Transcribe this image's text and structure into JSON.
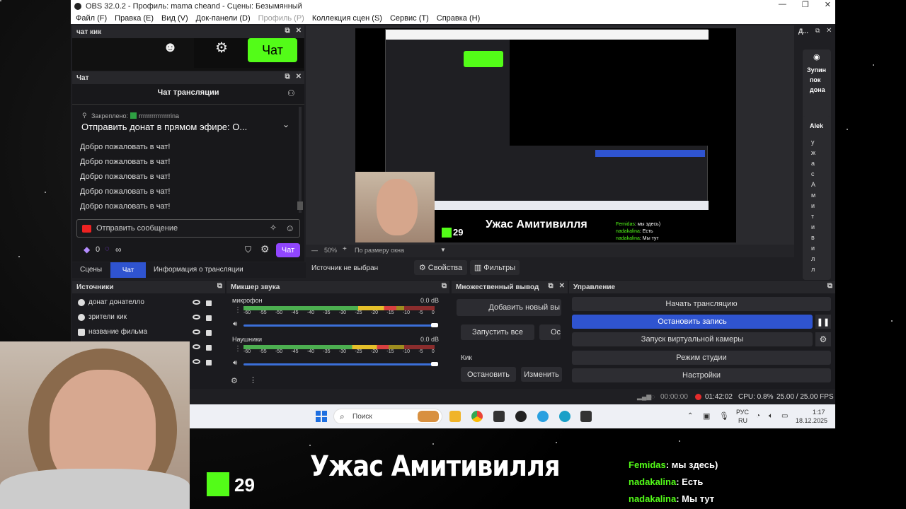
{
  "window": {
    "title": "OBS 32.0.2 - Профиль: mama cheand - Сцены: Безымянный",
    "controls": [
      "—",
      "❐",
      "✕"
    ]
  },
  "menu": [
    "Файл (F)",
    "Правка (E)",
    "Вид (V)",
    "Док-панели (D)",
    "Профиль (P)",
    "Коллекция сцен (S)",
    "Сервис (T)",
    "Справка (H)"
  ],
  "dock_kick": {
    "title": "чат кик",
    "chat_button": "Чат"
  },
  "dock_chat": {
    "title": "Чат",
    "header": "Чат трансляции",
    "pinned_label": "Закреплено:",
    "pinned_user": "rrrrrrrrrrrrrrrina",
    "pinned_message": "Отправить донат в прямом эфире: О...",
    "messages": [
      "Добро пожаловать в чат!",
      "Добро пожаловать в чат!",
      "Добро пожаловать в чат!",
      "Добро пожаловать в чат!",
      "Добро пожаловать в чат!"
    ],
    "input_placeholder": "Отправить сообщение",
    "points": "0",
    "infinity": "∞",
    "send_button": "Чат"
  },
  "tabs": [
    "Сцены",
    "Чат",
    "Информация о трансляции"
  ],
  "preview": {
    "zoom": "50%",
    "zoom_minus": "—",
    "zoom_plus": "+",
    "fit_label": "По размеру окна",
    "overlay_title": "Ужас Амитивилля",
    "kick_count": "29",
    "chat": [
      {
        "user": "Femidas",
        "text": "мы здесь)"
      },
      {
        "user": "nadakalina",
        "text": "Есть"
      },
      {
        "user": "nadakalina",
        "text": "Мы тут"
      }
    ]
  },
  "source_bar": {
    "status": "Источник не выбран",
    "properties": "Свойства",
    "filters": "Фильтры"
  },
  "sources": {
    "title": "Источники",
    "items": [
      "донат донателло",
      "зрители кик",
      "название фильма"
    ]
  },
  "mixer": {
    "title": "Микшер звука",
    "scale": [
      "-60",
      "-55",
      "-50",
      "-45",
      "-40",
      "-35",
      "-30",
      "-25",
      "-20",
      "-15",
      "-10",
      "-5",
      "0"
    ],
    "channels": [
      {
        "name": "микрофон",
        "level": "0.0 dB",
        "peak": 0.8,
        "volume": 1.0
      },
      {
        "name": "Наушники",
        "level": "0.0 dB",
        "peak": 0.76,
        "volume": 1.0
      }
    ]
  },
  "multi_output": {
    "title": "Множественный вывод",
    "add_new": "Добавить новый вы",
    "start_all": "Запустить все",
    "stop_all_partial": "Ост",
    "platform": "Кик",
    "stop": "Остановить",
    "edit": "Изменить"
  },
  "controls": {
    "title": "Управление",
    "start_stream": "Начать трансляцию",
    "stop_recording": "Остановить запись",
    "virtual_cam": "Запуск виртуальной камеры",
    "studio_mode": "Режим студии",
    "settings": "Настройки"
  },
  "statusbar": {
    "stream_time": "00:00:00",
    "rec_time": "01:42:02",
    "cpu": "CPU: 0.8%",
    "fps": "25.00 / 25.00 FPS"
  },
  "right_dock": {
    "title": "Д...",
    "stop_lines": [
      "Зупин",
      "пок",
      "дона"
    ],
    "name": "Alek",
    "letters": [
      "у",
      "ж",
      "а",
      "с",
      "А",
      "м",
      "и",
      "т",
      "и",
      "в",
      "и",
      "л",
      "л"
    ]
  },
  "taskbar": {
    "search": "Поиск",
    "lang_top": "РУС",
    "lang_bottom": "RU",
    "time": "1:17",
    "date": "18.12.2025"
  },
  "colors": {
    "accent_blue": "#2f54d0",
    "kick_green": "#53fc18",
    "twitch_purple": "#9146ff",
    "rec_red": "#e52b2b"
  }
}
